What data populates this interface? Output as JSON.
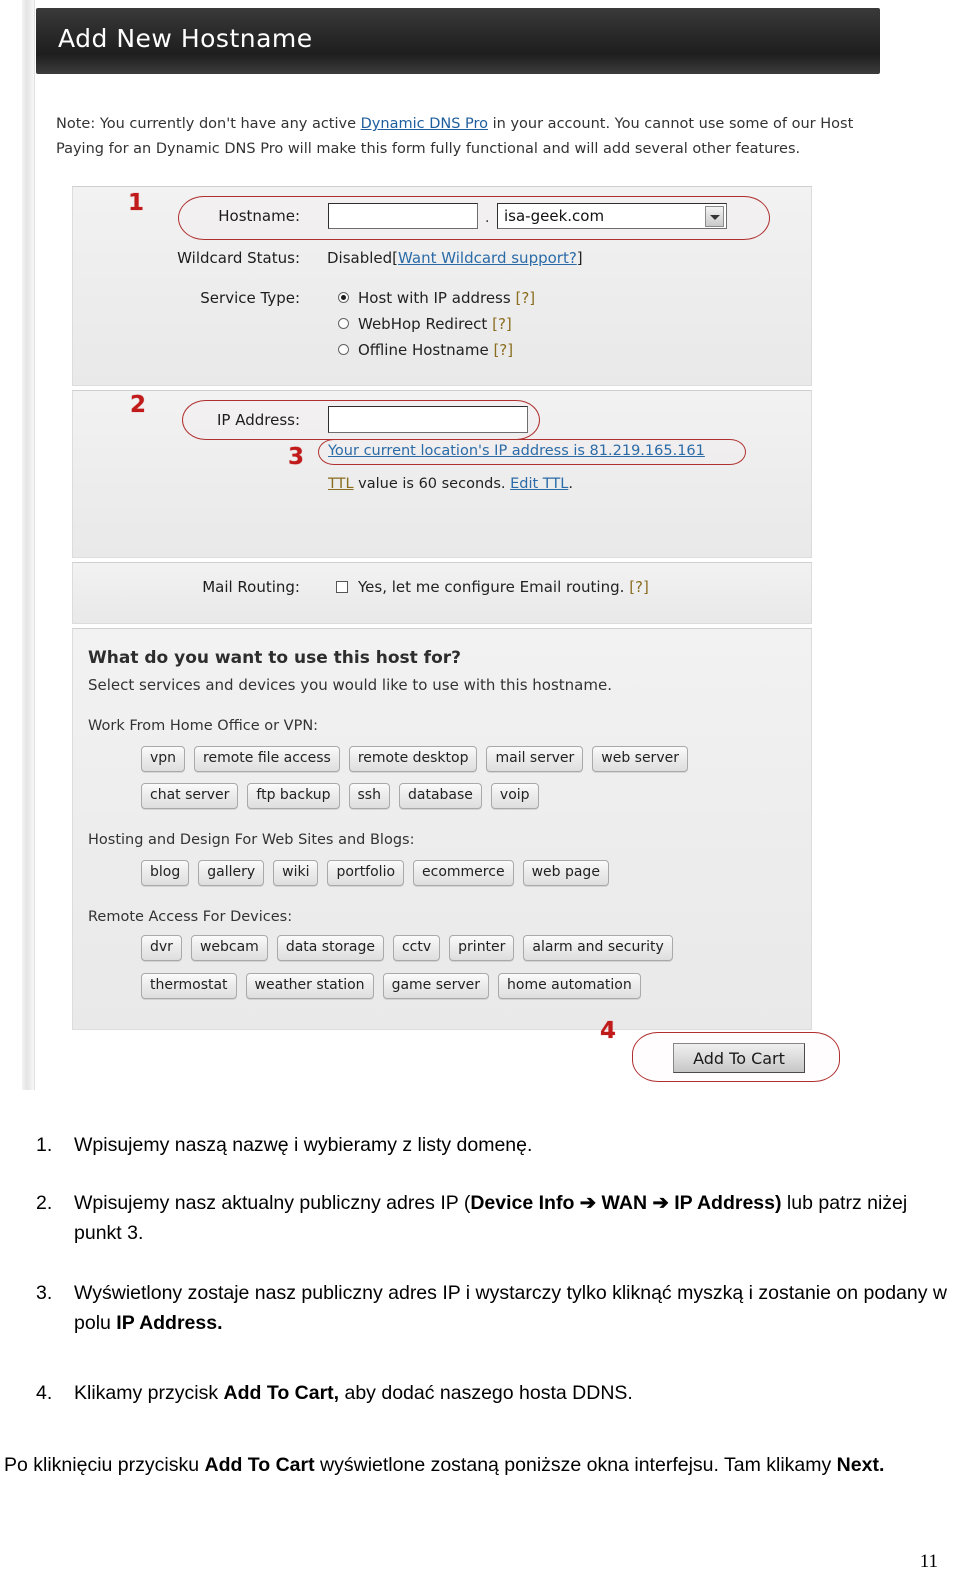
{
  "screenshot": {
    "window_title": "Add New Hostname",
    "note": {
      "line1_pre": "Note: You currently don't have any active ",
      "note_link": "Dynamic DNS Pro",
      "line1_post": " in your account. You cannot use some of our Host",
      "line2": "Paying for an Dynamic DNS Pro will make this form fully functional and will add several other features."
    },
    "hostname_section": {
      "callout": "1",
      "label": "Hostname:",
      "input_value": "",
      "input_placeholder": "",
      "dot": ".",
      "domain_selected": "isa-geek.com",
      "wildcard_label": "Wildcard Status:",
      "wildcard_value": "Disabled",
      "wildcard_bracket_open": "[",
      "wildcard_link": "Want Wildcard support?",
      "wildcard_bracket_close": "]",
      "service_type_label": "Service Type:",
      "service_options": [
        {
          "label": "Host with IP address",
          "help": "[?]",
          "selected": true
        },
        {
          "label": "WebHop Redirect",
          "help": "[?]",
          "selected": false
        },
        {
          "label": "Offline Hostname",
          "help": "[?]",
          "selected": false
        }
      ]
    },
    "ip_section": {
      "callout": "2",
      "label": "IP Address:",
      "input_value": "",
      "detect_callout": "3",
      "detect_link": "Your current location's IP address is 81.219.165.161",
      "ttl_link": "TTL",
      "ttl_text_mid": " value is 60 seconds. ",
      "ttl_edit_link": "Edit TTL",
      "ttl_period": "."
    },
    "mail_section": {
      "label": "Mail Routing:",
      "checkbox_checked": false,
      "checkbox_label": "Yes, let me configure Email routing.",
      "help": "[?]"
    },
    "use_section": {
      "heading": "What do you want to use this host for?",
      "subheading": "Select services and devices you would like to use with this hostname.",
      "groups": [
        {
          "label": "Work From Home Office or VPN:",
          "rows": [
            [
              "vpn",
              "remote file access",
              "remote desktop",
              "mail server",
              "web server"
            ],
            [
              "chat server",
              "ftp backup",
              "ssh",
              "database",
              "voip"
            ]
          ]
        },
        {
          "label": "Hosting and Design For Web Sites and Blogs:",
          "rows": [
            [
              "blog",
              "gallery",
              "wiki",
              "portfolio",
              "ecommerce",
              "web page"
            ]
          ]
        },
        {
          "label": "Remote Access For Devices:",
          "rows": [
            [
              "dvr",
              "webcam",
              "data storage",
              "cctv",
              "printer",
              "alarm and security"
            ],
            [
              "thermostat",
              "weather station",
              "game server",
              "home automation"
            ]
          ]
        }
      ]
    },
    "cart": {
      "callout": "4",
      "button_label": "Add To Cart"
    },
    "colors": {
      "callout_red": "#c11a1a",
      "highlight_red": "#b03030",
      "link_blue": "#1f5e9e",
      "titlebar_black": "#2b2b2b"
    }
  },
  "document": {
    "items": [
      {
        "num": "1.",
        "parts": [
          {
            "t": "Wpisujemy naszą nazwę i wybieramy z listy domenę.",
            "b": false
          }
        ]
      },
      {
        "num": "2.",
        "parts": [
          {
            "t": "Wpisujemy nasz aktualny publiczny adres IP (",
            "b": false
          },
          {
            "t": "Device Info ➔ WAN ➔ IP Address)",
            "b": true
          },
          {
            "t": " lub patrz niżej punkt 3.",
            "b": false
          }
        ]
      },
      {
        "num": "3.",
        "parts": [
          {
            "t": "Wyświetlony zostaje nasz publiczny adres IP i wystarczy tylko kliknąć myszką i zostanie on podany w polu ",
            "b": false
          },
          {
            "t": "IP Address.",
            "b": true
          }
        ]
      },
      {
        "num": "4.",
        "parts": [
          {
            "t": "Klikamy przycisk ",
            "b": false
          },
          {
            "t": "Add To Cart,",
            "b": true
          },
          {
            "t": " aby dodać naszego hosta DDNS.",
            "b": false
          }
        ]
      }
    ],
    "closing": [
      {
        "t": "Po kliknięciu przycisku ",
        "b": false
      },
      {
        "t": "Add To Cart",
        "b": true
      },
      {
        "t": " wyświetlone zostaną poniższe okna interfejsu. Tam klikamy ",
        "b": false
      },
      {
        "t": "Next.",
        "b": true
      }
    ],
    "page_number": "11"
  }
}
